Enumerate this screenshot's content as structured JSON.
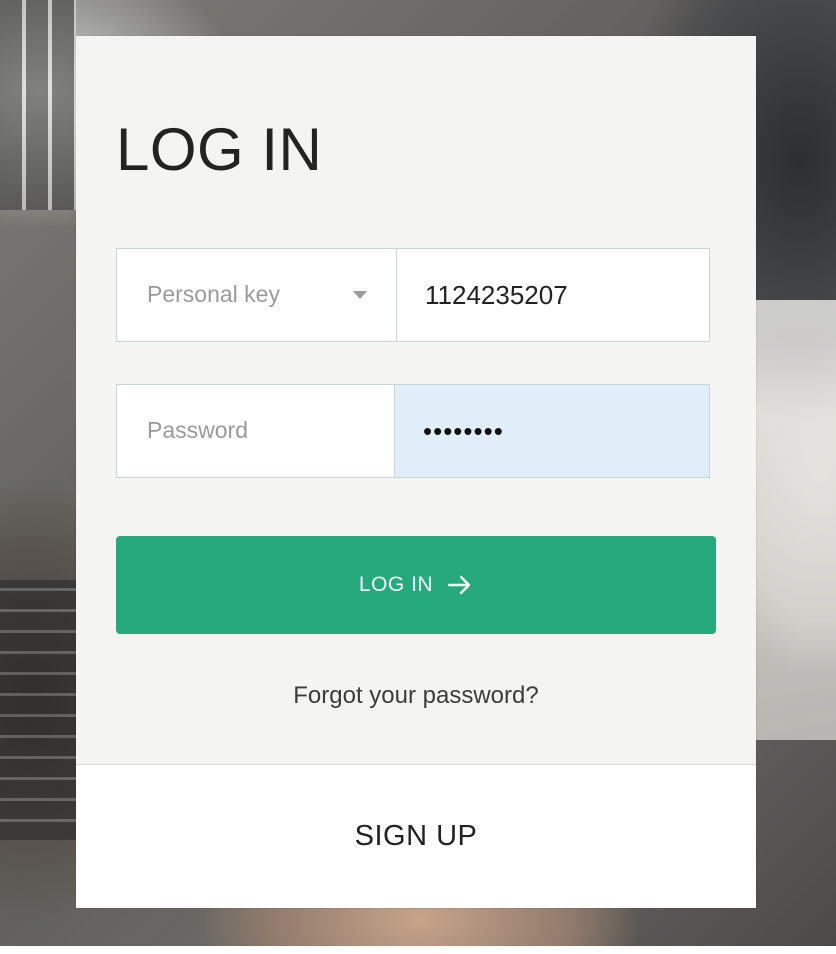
{
  "login": {
    "title": "LOG IN",
    "id_type": {
      "selected": "Personal key"
    },
    "id_value": "1124235207",
    "password": {
      "label": "Password",
      "value": "••••••••"
    },
    "submit_label": "LOG IN",
    "forgot_label": "Forgot your password?",
    "signup_label": "SIGN UP"
  },
  "colors": {
    "accent": "#26a97d",
    "autofill_bg": "#e2edfa",
    "card_bg": "#f4f4f2"
  },
  "icons": {
    "caret": "caret-down-icon",
    "submit_arrow": "arrow-right-icon"
  }
}
